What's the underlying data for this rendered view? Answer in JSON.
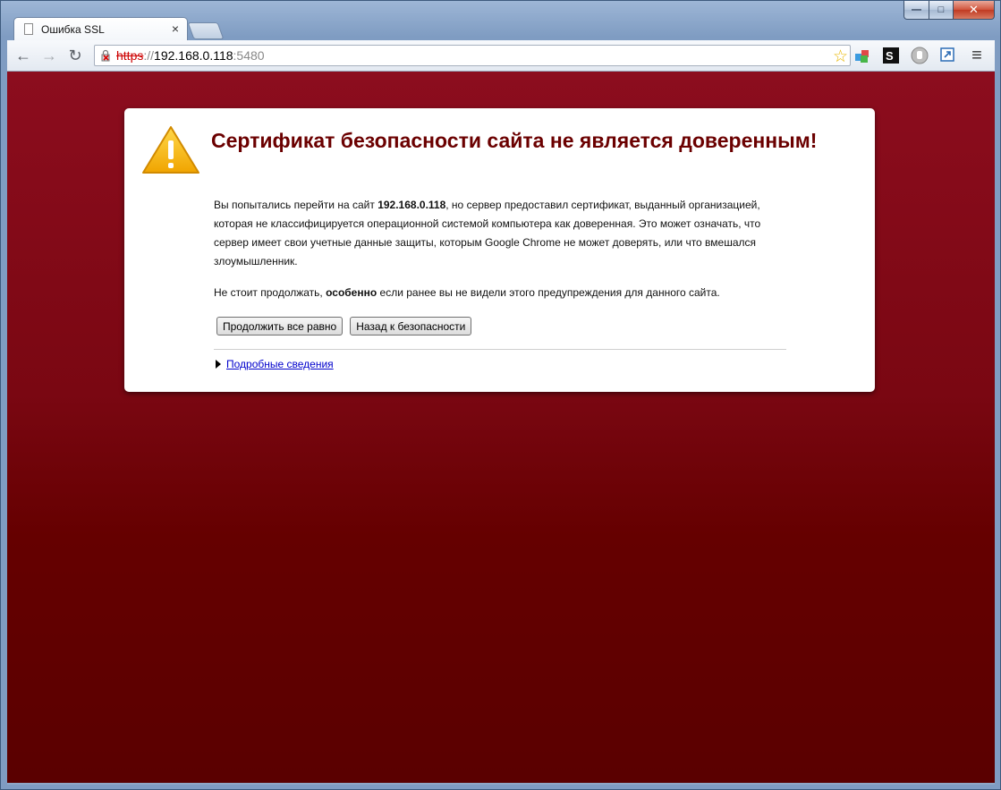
{
  "window": {
    "controls": {
      "minimize": "—",
      "maximize": "□",
      "close": "✕"
    }
  },
  "tab": {
    "title": "Ошибка SSL",
    "close": "×"
  },
  "toolbar": {
    "back": "←",
    "forward": "→",
    "reload": "↻",
    "url": {
      "scheme": "https",
      "sep": "://",
      "host": "192.168.0.118",
      "port": ":5480"
    },
    "star": "☆",
    "menu": "≡"
  },
  "page": {
    "headline": "Сертификат безопасности сайта не является доверенным!",
    "p1_before": "Вы попытались перейти на сайт ",
    "p1_host": "192.168.0.118",
    "p1_after": ", но сервер предоставил сертификат, выданный организацией, которая не классифицируется операционной системой компьютера как доверенная. Это может означать, что сервер имеет свои учетные данные защиты, которым Google Chrome не может доверять, или что вмешался злоумышленник.",
    "p2_before": "Не стоит продолжать, ",
    "p2_bold": "особенно",
    "p2_after": " если ранее вы не видели этого предупреждения для данного сайта.",
    "proceed_label": "Продолжить все равно",
    "back_label": "Назад к безопасности",
    "details_label": "Подробные сведения"
  },
  "colors": {
    "headline": "#6b0000",
    "bg_top": "#8c0d1e",
    "bg_bottom": "#5a0000",
    "link": "#0000cc"
  }
}
